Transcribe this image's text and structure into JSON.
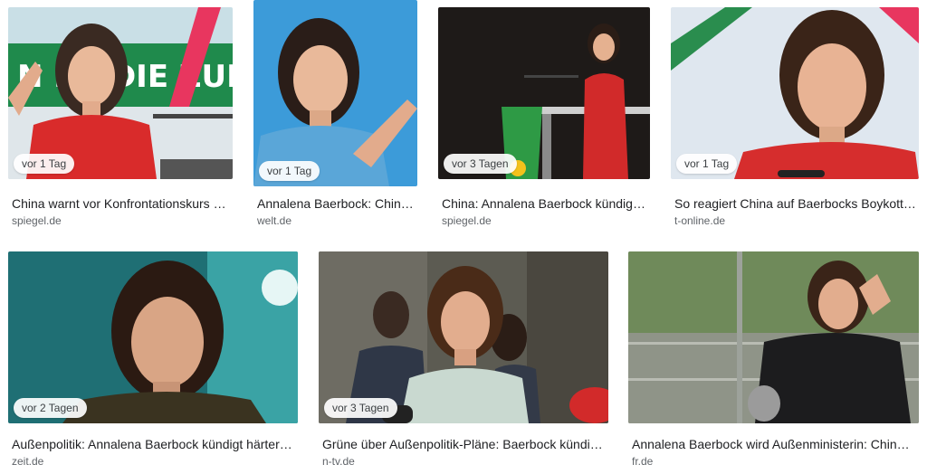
{
  "results": [
    {
      "age": "vor 1 Tag",
      "title": "China warnt vor Konfrontationskurs mit Annalena Baerbock",
      "source": "spiegel.de",
      "image_alt": "Annalena Baerbock speaking at a Green party event"
    },
    {
      "age": "vor 1 Tag",
      "title": "Annalena Baerbock: China warnt",
      "source": "welt.de",
      "image_alt": "Annalena Baerbock pointing"
    },
    {
      "age": "vor 3 Tagen",
      "title": "China: Annalena Baerbock kündigt härteren Kurs an",
      "source": "spiegel.de",
      "image_alt": "Annalena Baerbock at a podium"
    },
    {
      "age": "vor 1 Tag",
      "title": "So reagiert China auf Baerbocks Boykott-Forderung",
      "source": "t-online.de",
      "image_alt": "Annalena Baerbock portrait"
    },
    {
      "age": "vor 2 Tagen",
      "title": "Außenpolitik: Annalena Baerbock kündigt härteren Kurs an",
      "source": "zeit.de",
      "image_alt": "Annalena Baerbock speaking"
    },
    {
      "age": "vor 3 Tagen",
      "title": "Grüne über Außenpolitik-Pläne: Baerbock kündigt härteren Kurs an",
      "source": "n-tv.de",
      "image_alt": "Annalena Baerbock at a press statement"
    },
    {
      "age": "",
      "title": "Annalena Baerbock wird Außenministerin: China warnt",
      "source": "fr.de",
      "image_alt": "Annalena Baerbock outdoors"
    }
  ]
}
